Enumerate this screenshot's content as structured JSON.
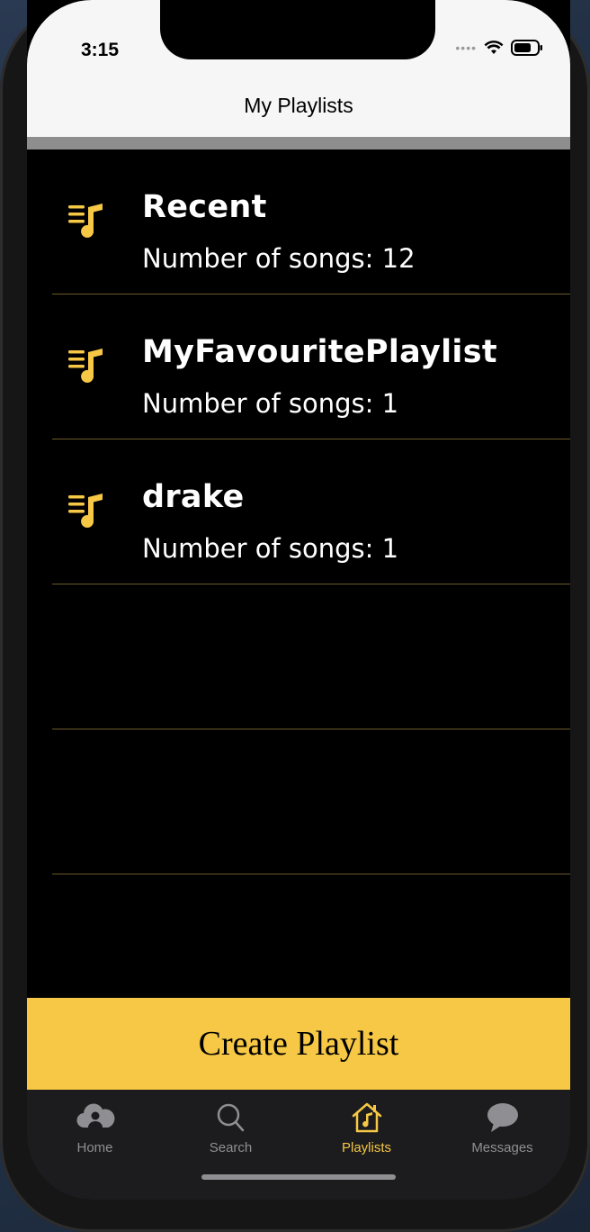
{
  "status_bar": {
    "time": "3:15"
  },
  "nav": {
    "title": "My Playlists"
  },
  "playlists": [
    {
      "name": "Recent",
      "songs_label": "Number of songs: 12"
    },
    {
      "name": "MyFavouritePlaylist",
      "songs_label": "Number of songs: 1"
    },
    {
      "name": "drake",
      "songs_label": "Number of songs: 1"
    }
  ],
  "create_button": {
    "label": "Create Playlist"
  },
  "tabs": [
    {
      "label": "Home",
      "icon": "cloud-user-icon"
    },
    {
      "label": "Search",
      "icon": "magnifier-icon"
    },
    {
      "label": "Playlists",
      "icon": "house-music-icon",
      "active": true
    },
    {
      "label": "Messages",
      "icon": "chat-bubble-icon"
    }
  ],
  "colors": {
    "accent": "#f6c845",
    "background": "#000000",
    "tabbar": "#1c1c1e",
    "divider": "#6b5a2a"
  }
}
